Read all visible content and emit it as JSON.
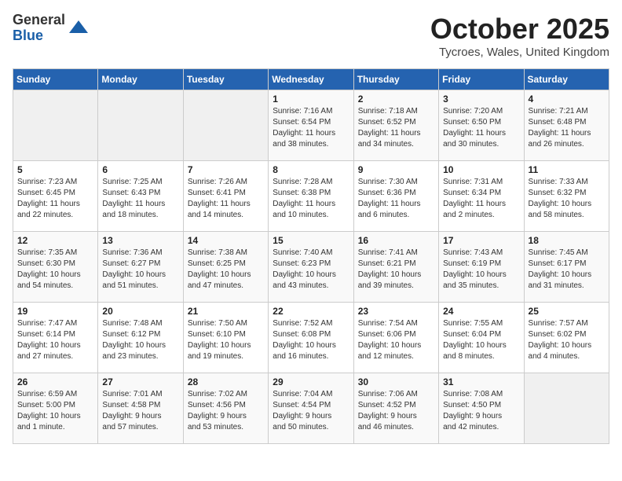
{
  "header": {
    "logo_general": "General",
    "logo_blue": "Blue",
    "month": "October 2025",
    "location": "Tycroes, Wales, United Kingdom"
  },
  "weekdays": [
    "Sunday",
    "Monday",
    "Tuesday",
    "Wednesday",
    "Thursday",
    "Friday",
    "Saturday"
  ],
  "weeks": [
    [
      {
        "day": "",
        "content": ""
      },
      {
        "day": "",
        "content": ""
      },
      {
        "day": "",
        "content": ""
      },
      {
        "day": "1",
        "content": "Sunrise: 7:16 AM\nSunset: 6:54 PM\nDaylight: 11 hours\nand 38 minutes."
      },
      {
        "day": "2",
        "content": "Sunrise: 7:18 AM\nSunset: 6:52 PM\nDaylight: 11 hours\nand 34 minutes."
      },
      {
        "day": "3",
        "content": "Sunrise: 7:20 AM\nSunset: 6:50 PM\nDaylight: 11 hours\nand 30 minutes."
      },
      {
        "day": "4",
        "content": "Sunrise: 7:21 AM\nSunset: 6:48 PM\nDaylight: 11 hours\nand 26 minutes."
      }
    ],
    [
      {
        "day": "5",
        "content": "Sunrise: 7:23 AM\nSunset: 6:45 PM\nDaylight: 11 hours\nand 22 minutes."
      },
      {
        "day": "6",
        "content": "Sunrise: 7:25 AM\nSunset: 6:43 PM\nDaylight: 11 hours\nand 18 minutes."
      },
      {
        "day": "7",
        "content": "Sunrise: 7:26 AM\nSunset: 6:41 PM\nDaylight: 11 hours\nand 14 minutes."
      },
      {
        "day": "8",
        "content": "Sunrise: 7:28 AM\nSunset: 6:38 PM\nDaylight: 11 hours\nand 10 minutes."
      },
      {
        "day": "9",
        "content": "Sunrise: 7:30 AM\nSunset: 6:36 PM\nDaylight: 11 hours\nand 6 minutes."
      },
      {
        "day": "10",
        "content": "Sunrise: 7:31 AM\nSunset: 6:34 PM\nDaylight: 11 hours\nand 2 minutes."
      },
      {
        "day": "11",
        "content": "Sunrise: 7:33 AM\nSunset: 6:32 PM\nDaylight: 10 hours\nand 58 minutes."
      }
    ],
    [
      {
        "day": "12",
        "content": "Sunrise: 7:35 AM\nSunset: 6:30 PM\nDaylight: 10 hours\nand 54 minutes."
      },
      {
        "day": "13",
        "content": "Sunrise: 7:36 AM\nSunset: 6:27 PM\nDaylight: 10 hours\nand 51 minutes."
      },
      {
        "day": "14",
        "content": "Sunrise: 7:38 AM\nSunset: 6:25 PM\nDaylight: 10 hours\nand 47 minutes."
      },
      {
        "day": "15",
        "content": "Sunrise: 7:40 AM\nSunset: 6:23 PM\nDaylight: 10 hours\nand 43 minutes."
      },
      {
        "day": "16",
        "content": "Sunrise: 7:41 AM\nSunset: 6:21 PM\nDaylight: 10 hours\nand 39 minutes."
      },
      {
        "day": "17",
        "content": "Sunrise: 7:43 AM\nSunset: 6:19 PM\nDaylight: 10 hours\nand 35 minutes."
      },
      {
        "day": "18",
        "content": "Sunrise: 7:45 AM\nSunset: 6:17 PM\nDaylight: 10 hours\nand 31 minutes."
      }
    ],
    [
      {
        "day": "19",
        "content": "Sunrise: 7:47 AM\nSunset: 6:14 PM\nDaylight: 10 hours\nand 27 minutes."
      },
      {
        "day": "20",
        "content": "Sunrise: 7:48 AM\nSunset: 6:12 PM\nDaylight: 10 hours\nand 23 minutes."
      },
      {
        "day": "21",
        "content": "Sunrise: 7:50 AM\nSunset: 6:10 PM\nDaylight: 10 hours\nand 19 minutes."
      },
      {
        "day": "22",
        "content": "Sunrise: 7:52 AM\nSunset: 6:08 PM\nDaylight: 10 hours\nand 16 minutes."
      },
      {
        "day": "23",
        "content": "Sunrise: 7:54 AM\nSunset: 6:06 PM\nDaylight: 10 hours\nand 12 minutes."
      },
      {
        "day": "24",
        "content": "Sunrise: 7:55 AM\nSunset: 6:04 PM\nDaylight: 10 hours\nand 8 minutes."
      },
      {
        "day": "25",
        "content": "Sunrise: 7:57 AM\nSunset: 6:02 PM\nDaylight: 10 hours\nand 4 minutes."
      }
    ],
    [
      {
        "day": "26",
        "content": "Sunrise: 6:59 AM\nSunset: 5:00 PM\nDaylight: 10 hours\nand 1 minute."
      },
      {
        "day": "27",
        "content": "Sunrise: 7:01 AM\nSunset: 4:58 PM\nDaylight: 9 hours\nand 57 minutes."
      },
      {
        "day": "28",
        "content": "Sunrise: 7:02 AM\nSunset: 4:56 PM\nDaylight: 9 hours\nand 53 minutes."
      },
      {
        "day": "29",
        "content": "Sunrise: 7:04 AM\nSunset: 4:54 PM\nDaylight: 9 hours\nand 50 minutes."
      },
      {
        "day": "30",
        "content": "Sunrise: 7:06 AM\nSunset: 4:52 PM\nDaylight: 9 hours\nand 46 minutes."
      },
      {
        "day": "31",
        "content": "Sunrise: 7:08 AM\nSunset: 4:50 PM\nDaylight: 9 hours\nand 42 minutes."
      },
      {
        "day": "",
        "content": ""
      }
    ]
  ]
}
